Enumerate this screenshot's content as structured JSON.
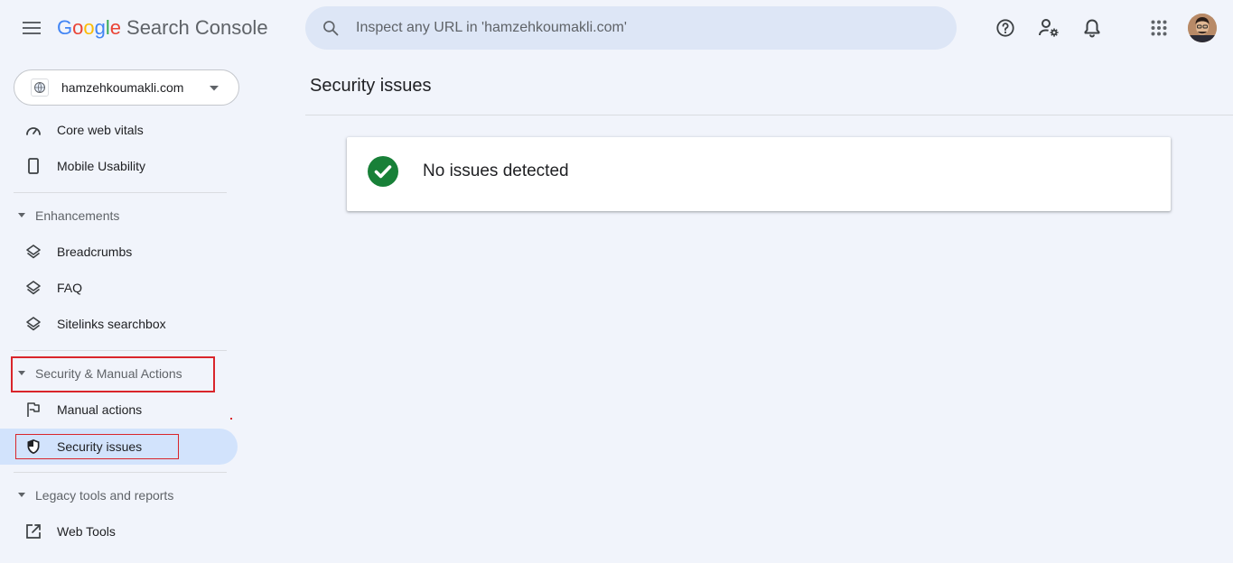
{
  "header": {
    "menu_icon": "hamburger-menu-icon",
    "logo": {
      "letters": [
        {
          "char": "G",
          "color": "#4285F4"
        },
        {
          "char": "o",
          "color": "#EA4335"
        },
        {
          "char": "o",
          "color": "#FBBC05"
        },
        {
          "char": "g",
          "color": "#4285F4"
        },
        {
          "char": "l",
          "color": "#34A853"
        },
        {
          "char": "e",
          "color": "#EA4335"
        }
      ],
      "product": "Search Console"
    },
    "search": {
      "icon": "search-icon",
      "placeholder": "Inspect any URL in 'hamzehkoumakli.com'"
    },
    "icons": [
      "help-icon",
      "manage-users-icon",
      "notifications-icon",
      "apps-icon"
    ]
  },
  "sidebar": {
    "property": {
      "icon": "globe-icon",
      "label": "hamzehkoumakli.com"
    },
    "items": {
      "core_web_vitals": {
        "label": "Core web vitals",
        "icon": "speedometer-icon"
      },
      "mobile_usability": {
        "label": "Mobile Usability",
        "icon": "phone-icon"
      },
      "enhancements": {
        "label": "Enhancements"
      },
      "breadcrumbs": {
        "label": "Breadcrumbs",
        "icon": "layers-icon"
      },
      "faq": {
        "label": "FAQ",
        "icon": "layers-icon"
      },
      "sitelinks": {
        "label": "Sitelinks searchbox",
        "icon": "layers-icon"
      },
      "security_manual": {
        "label": "Security & Manual Actions"
      },
      "manual_actions": {
        "label": "Manual actions",
        "icon": "flag-icon"
      },
      "security_issues": {
        "label": "Security issues",
        "icon": "shield-icon",
        "active": true
      },
      "legacy": {
        "label": "Legacy tools and reports"
      },
      "web_tools": {
        "label": "Web Tools",
        "icon": "external-link-icon"
      }
    }
  },
  "main": {
    "title": "Security issues",
    "card": {
      "icon": "check-circle-icon",
      "text": "No issues detected",
      "status_color": "#188038"
    }
  },
  "colors": {
    "background": "#f1f4fb",
    "search_bg": "#dde6f6",
    "active_nav_bg": "#d2e3fc",
    "annotation_red": "#d9252b"
  }
}
